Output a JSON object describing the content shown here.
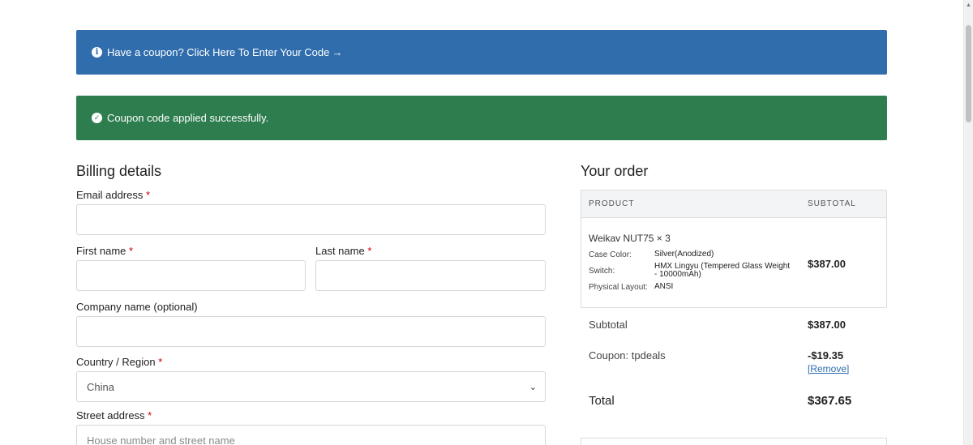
{
  "notices": {
    "coupon_prompt": "Have a coupon? Click Here To Enter Your Code",
    "coupon_arrow": "→",
    "coupon_success": "Coupon code applied successfully."
  },
  "billing": {
    "title": "Billing details",
    "email_label": "Email address",
    "first_name_label": "First name",
    "last_name_label": "Last name",
    "company_label": "Company name (optional)",
    "country_label": "Country / Region",
    "country_value": "China",
    "street_label": "Street address",
    "street_placeholder": "House number and street name",
    "required_mark": "*"
  },
  "order": {
    "title": "Your order",
    "col_product": "PRODUCT",
    "col_subtotal": "SUBTOTAL",
    "item": {
      "name": "Weikav NUT75  × 3",
      "meta": [
        {
          "key": "Case Color:",
          "value": "Silver(Anodized)"
        },
        {
          "key": "Switch:",
          "value": "HMX Lingyu (Tempered Glass Weight - 10000mAh)"
        },
        {
          "key": "Physical Layout:",
          "value": "ANSI"
        }
      ],
      "total": "$387.00"
    },
    "subtotal_label": "Subtotal",
    "subtotal_value": "$387.00",
    "coupon_label": "Coupon: tpdeals",
    "coupon_value": "-$19.35",
    "remove_label": "[Remove]",
    "total_label": "Total",
    "total_value": "$367.65"
  },
  "colors": {
    "info": "#2f6dad",
    "success": "#2e7d4f",
    "required": "#cc0000"
  }
}
